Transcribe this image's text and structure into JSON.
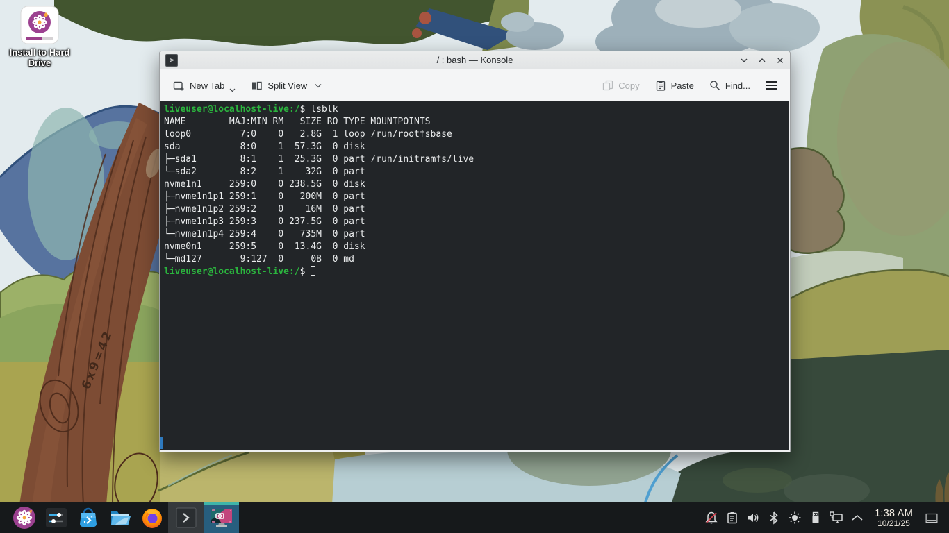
{
  "desktop": {
    "install_icon_label": "Install to Hard Drive"
  },
  "window": {
    "title": "/ : bash — Konsole",
    "toolbar": {
      "new_tab": "New Tab",
      "split_view": "Split View",
      "copy": "Copy",
      "paste": "Paste",
      "find": "Find..."
    }
  },
  "terminal": {
    "prompt_user": "liveuser@localhost-live",
    "prompt_path": ":/",
    "lines": [
      {
        "type": "prompt",
        "command": "lsblk"
      },
      {
        "type": "output",
        "text": "NAME        MAJ:MIN RM   SIZE RO TYPE MOUNTPOINTS"
      },
      {
        "type": "output",
        "text": "loop0         7:0    0   2.8G  1 loop /run/rootfsbase"
      },
      {
        "type": "output",
        "text": "sda           8:0    1  57.3G  0 disk "
      },
      {
        "type": "output",
        "text": "├─sda1        8:1    1  25.3G  0 part /run/initramfs/live"
      },
      {
        "type": "output",
        "text": "└─sda2        8:2    1    32G  0 part "
      },
      {
        "type": "output",
        "text": "nvme1n1     259:0    0 238.5G  0 disk "
      },
      {
        "type": "output",
        "text": "├─nvme1n1p1 259:1    0   200M  0 part "
      },
      {
        "type": "output",
        "text": "├─nvme1n1p2 259:2    0    16M  0 part "
      },
      {
        "type": "output",
        "text": "├─nvme1n1p3 259:3    0 237.5G  0 part "
      },
      {
        "type": "output",
        "text": "└─nvme1n1p4 259:4    0   735M  0 part "
      },
      {
        "type": "output",
        "text": "nvme0n1     259:5    0  13.4G  0 disk "
      },
      {
        "type": "output",
        "text": "└─md127       9:127  0     0B  0 md "
      },
      {
        "type": "prompt",
        "command": "",
        "cursor": true
      }
    ]
  },
  "taskbar": {
    "clock_time": "1:38 AM",
    "clock_date": "10/21/25"
  },
  "colors": {
    "prompt_green": "#2bb53e",
    "terminal_bg": "#222528",
    "taskbar_bg": "#16191b",
    "active_task_stripe": "#3fb5a9",
    "active_task_bg": "#275e7e",
    "scroll_indicator_blue": "#2e79bd",
    "installer_purple": "#9c4190",
    "dnd_slash_red": "#da4453"
  }
}
